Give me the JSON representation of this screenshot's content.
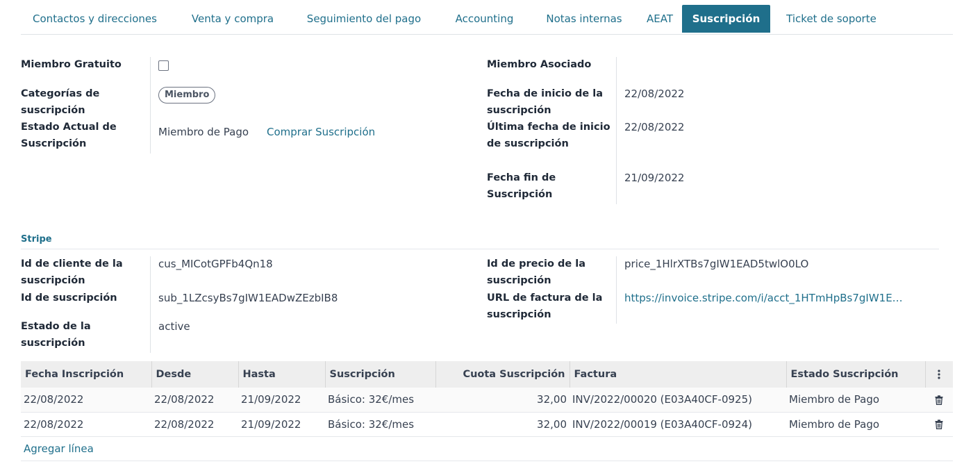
{
  "tabs": [
    "Contactos y direcciones",
    "Venta y compra",
    "Seguimiento del pago",
    "Accounting",
    "Notas internas",
    "AEAT",
    "Suscripción",
    "Ticket de soporte"
  ],
  "active_tab": "Suscripción",
  "membership": {
    "free_member_label": "Miembro Gratuito",
    "free_member_checked": false,
    "categories_label": "Categorías de suscripción",
    "categories_tag": "Miembro",
    "current_state_label": "Estado Actual de Suscripción",
    "current_state_value": "Miembro de Pago",
    "buy_link": "Comprar Suscripción",
    "associate_label": "Miembro Asociado",
    "associate_value": "",
    "start_date_label": "Fecha de inicio de la suscripción",
    "start_date_value": "22/08/2022",
    "last_start_label": "Última fecha de inicio de suscripción",
    "last_start_value": "22/08/2022",
    "end_date_label": "Fecha fin de Suscripción",
    "end_date_value": "21/09/2022"
  },
  "stripe": {
    "section_title": "Stripe",
    "customer_id_label": "Id de cliente de la suscripción",
    "customer_id_value": "cus_MICotGPFb4Qn18",
    "subscription_id_label": "Id de suscripción",
    "subscription_id_value": "sub_1LZcsyBs7gIW1EADwZEzbIB8",
    "status_label": "Estado de la suscripción",
    "status_value": "active",
    "price_id_label": "Id de precio de la suscripción",
    "price_id_value": "price_1HlrXTBs7gIW1EAD5twlO0LO",
    "invoice_url_label": "URL de factura de la suscripción",
    "invoice_url_value": "https://invoice.stripe.com/i/acct_1HTmHpBs7gIW1E…"
  },
  "lines_table": {
    "columns": [
      "Fecha Inscripción",
      "Desde",
      "Hasta",
      "Suscripción",
      "Cuota Suscripción",
      "Factura",
      "Estado Suscripción"
    ],
    "rows": [
      [
        "22/08/2022",
        "22/08/2022",
        "21/09/2022",
        "Básico: 32€/mes",
        "32,00",
        "INV/2022/00020 (E03A40CF-0925)",
        "Miembro de Pago"
      ],
      [
        "22/08/2022",
        "22/08/2022",
        "21/09/2022",
        "Básico: 32€/mes",
        "32,00",
        "INV/2022/00019 (E03A40CF-0924)",
        "Miembro de Pago"
      ]
    ],
    "add_line": "Agregar línea"
  },
  "colors": {
    "accent": "#1f6f8b",
    "header_bg": "#eeeeee"
  }
}
